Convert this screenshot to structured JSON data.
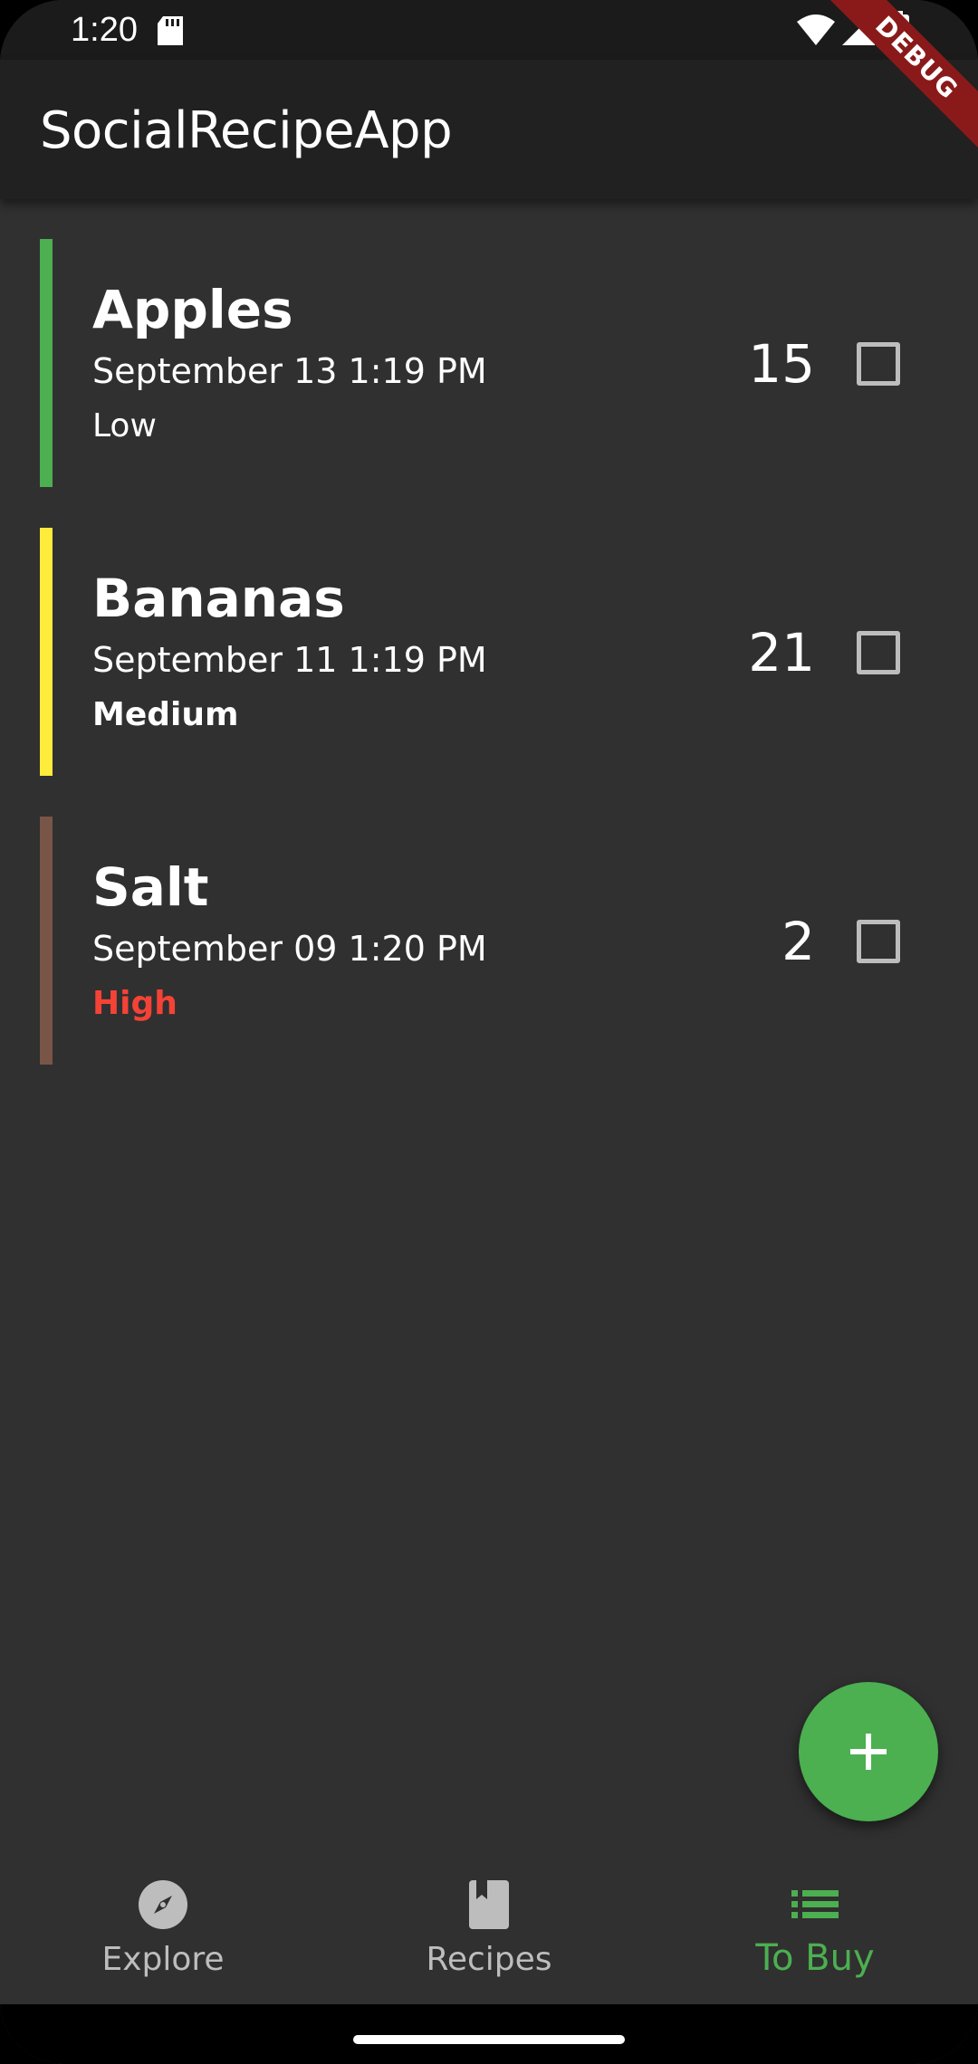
{
  "status_bar": {
    "time": "1:20",
    "icons": [
      "sd-card-icon",
      "wifi-icon",
      "cell-signal-icon",
      "battery-icon"
    ]
  },
  "app_bar": {
    "title": "SocialRecipeApp"
  },
  "debug_banner": "DEBUG",
  "items": [
    {
      "name": "Apples",
      "date": "September 13 1:19 PM",
      "priority": "Low",
      "quantity": "15",
      "checked": false,
      "color": "#4caf50",
      "priority_color": "#ffffff",
      "priority_weight": "normal"
    },
    {
      "name": "Bananas",
      "date": "September 11 1:19 PM",
      "priority": "Medium",
      "quantity": "21",
      "checked": false,
      "color": "#ffeb3b",
      "priority_color": "#ffffff",
      "priority_weight": "bold"
    },
    {
      "name": "Salt",
      "date": "September 09 1:20 PM",
      "priority": "High",
      "quantity": "2",
      "checked": false,
      "color": "#795548",
      "priority_color": "#f44336",
      "priority_weight": "bold"
    }
  ],
  "fab": {
    "icon": "plus-icon",
    "color": "#4caf50"
  },
  "bottom_nav": {
    "items": [
      {
        "label": "Explore",
        "icon": "compass-icon",
        "active": false
      },
      {
        "label": "Recipes",
        "icon": "book-icon",
        "active": false
      },
      {
        "label": "To Buy",
        "icon": "list-icon",
        "active": true
      }
    ],
    "active_color": "#4caf50",
    "inactive_color": "#bdbdbd"
  }
}
